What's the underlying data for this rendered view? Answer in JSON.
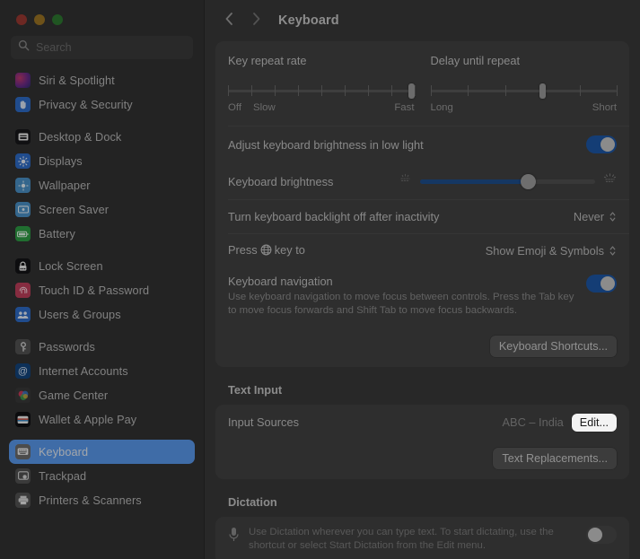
{
  "window": {
    "traffic_lights": [
      "close",
      "minimize",
      "zoom"
    ]
  },
  "sidebar": {
    "search": {
      "placeholder": "Search",
      "value": ""
    },
    "groups": [
      {
        "items": [
          {
            "label": "Siri & Spotlight",
            "icon": "siri-icon"
          },
          {
            "label": "Privacy & Security",
            "icon": "privacy-hand-icon"
          }
        ]
      },
      {
        "items": [
          {
            "label": "Desktop & Dock",
            "icon": "desktop-dock-icon"
          },
          {
            "label": "Displays",
            "icon": "displays-icon"
          },
          {
            "label": "Wallpaper",
            "icon": "wallpaper-icon"
          },
          {
            "label": "Screen Saver",
            "icon": "screen-saver-icon"
          },
          {
            "label": "Battery",
            "icon": "battery-icon"
          }
        ]
      },
      {
        "items": [
          {
            "label": "Lock Screen",
            "icon": "lock-screen-icon"
          },
          {
            "label": "Touch ID & Password",
            "icon": "touch-id-icon"
          },
          {
            "label": "Users & Groups",
            "icon": "users-groups-icon"
          }
        ]
      },
      {
        "items": [
          {
            "label": "Passwords",
            "icon": "passwords-key-icon"
          },
          {
            "label": "Internet Accounts",
            "icon": "internet-accounts-icon"
          },
          {
            "label": "Game Center",
            "icon": "game-center-icon"
          },
          {
            "label": "Wallet & Apple Pay",
            "icon": "wallet-icon"
          }
        ]
      },
      {
        "items": [
          {
            "label": "Keyboard",
            "icon": "keyboard-icon",
            "selected": true
          },
          {
            "label": "Trackpad",
            "icon": "trackpad-icon"
          },
          {
            "label": "Printers & Scanners",
            "icon": "printers-scanners-icon"
          }
        ]
      }
    ],
    "selected": "Keyboard",
    "selection_color": "#5b9bf0"
  },
  "header": {
    "back_icon": "chevron-left-icon",
    "forward_icon": "chevron-right-icon",
    "title": "Keyboard"
  },
  "keyboard": {
    "key_repeat": {
      "title": "Key repeat rate",
      "left_label": "Off",
      "second_label": "Slow",
      "right_label": "Fast",
      "ticks": 9,
      "value_index": 8
    },
    "delay_until_repeat": {
      "title": "Delay until repeat",
      "left_label": "Long",
      "right_label": "Short",
      "ticks": 6,
      "value_index": 3
    },
    "adjust_brightness": {
      "label": "Adjust keyboard brightness in low light",
      "toggle": "on"
    },
    "brightness": {
      "label": "Keyboard brightness",
      "percent": 62,
      "low_icon": "keyboard-brightness-low-icon",
      "high_icon": "keyboard-brightness-high-icon"
    },
    "backlight_off": {
      "label": "Turn keyboard backlight off after inactivity",
      "value": "Never",
      "menu_icon": "up-down-chevrons-icon"
    },
    "globe_key": {
      "label_before": "Press",
      "label_after": "key to",
      "globe_icon": "globe-icon",
      "value": "Show Emoji & Symbols",
      "menu_icon": "up-down-chevrons-icon"
    },
    "keyboard_navigation": {
      "title": "Keyboard navigation",
      "description": "Use keyboard navigation to move focus between controls. Press the Tab key to move focus forwards and Shift Tab to move focus backwards.",
      "toggle": "on"
    },
    "shortcuts_button": "Keyboard Shortcuts..."
  },
  "text_input": {
    "section_title": "Text Input",
    "input_sources": {
      "label": "Input Sources",
      "value": "ABC – India",
      "edit_button": "Edit..."
    },
    "text_replacements_button": "Text Replacements..."
  },
  "dictation": {
    "section_title": "Dictation",
    "mic_icon": "microphone-icon",
    "description": "Use Dictation wherever you can type text. To start dictating, use the shortcut or select Start Dictation from the Edit menu.",
    "toggle": "off"
  },
  "colors": {
    "accent_blue": "#1e58a8",
    "selection_blue": "#5b9bf0",
    "card_bg": "#424242",
    "window_bg": "#3a3a3a",
    "sidebar_bg": "#333333"
  }
}
